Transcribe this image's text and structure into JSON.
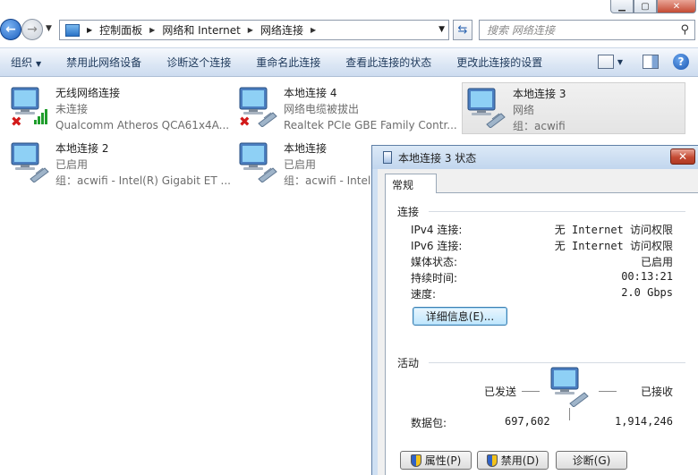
{
  "address": {
    "crumbs": [
      "控制面板",
      "网络和 Internet",
      "网络连接"
    ],
    "search_placeholder": "搜索 网络连接"
  },
  "toolbar": {
    "items": [
      "组织",
      "禁用此网络设备",
      "诊断这个连接",
      "重命名此连接",
      "查看此连接的状态",
      "更改此连接的设置"
    ]
  },
  "connections": [
    {
      "name": "无线网络连接",
      "status": "未连接",
      "device": "Qualcomm Atheros QCA61x4A...",
      "type": "wireless",
      "error": true
    },
    {
      "name": "本地连接 4",
      "status": "网络电缆被拔出",
      "device": "Realtek PCIe GBE Family Contr...",
      "type": "wired",
      "error": true
    },
    {
      "name": "本地连接 3",
      "status": "网络",
      "device": "组：acwifi",
      "type": "wired",
      "error": false,
      "selected": true
    },
    {
      "name": "本地连接 2",
      "status": "已启用",
      "device": "组：acwifi - Intel(R) Gigabit ET ...",
      "type": "wired",
      "error": false
    },
    {
      "name": "本地连接",
      "status": "已启用",
      "device": "组：acwifi - Intel",
      "type": "wired",
      "error": false
    }
  ],
  "dialog": {
    "title": "本地连接 3 状态",
    "close_label": "✕",
    "tab": "常规",
    "connection_group": "连接",
    "rows": [
      {
        "label": "IPv4 连接:",
        "value": "无 Internet 访问权限"
      },
      {
        "label": "IPv6 连接:",
        "value": "无 Internet 访问权限"
      },
      {
        "label": "媒体状态:",
        "value": "已启用"
      },
      {
        "label": "持续时间:",
        "value": "00:13:21"
      },
      {
        "label": "速度:",
        "value": "2.0 Gbps"
      }
    ],
    "details_button": "详细信息(E)...",
    "activity_group": "活动",
    "sent_label": "已发送",
    "received_label": "已接收",
    "packets_label": "数据包:",
    "packets_sent": "697,602",
    "packets_received": "1,914,246",
    "buttons": [
      "属性(P)",
      "禁用(D)",
      "诊断(G)"
    ]
  }
}
